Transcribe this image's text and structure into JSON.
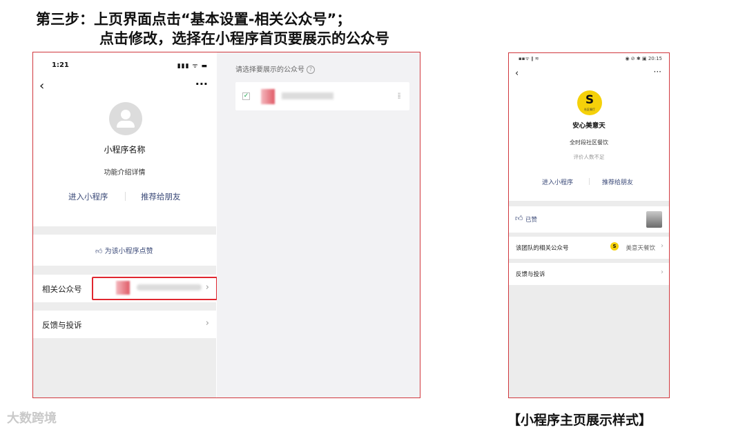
{
  "heading": {
    "line1": "第三步：上页界面点击“基本设置-相关公众号”；",
    "line2": "点击修改，选择在小程序首页要展示的公众号"
  },
  "left_phone": {
    "status_time": "1:21",
    "status_icons": "▮▮▮ ᯤ ▬",
    "back_icon": "chevron-left-icon",
    "more_icon": "more-icon",
    "app_name": "小程序名称",
    "app_desc": "功能介绍详情",
    "enter_label": "进入小程序",
    "recommend_label": "推荐给朋友",
    "like_label": "为该小程序点赞",
    "related_label": "相关公众号",
    "feedback_label": "反馈与投诉",
    "chevron": "›"
  },
  "picker_panel": {
    "prompt": "请选择要展示的公众号",
    "help": "?",
    "check": "✓",
    "grip": "⁞⁞"
  },
  "right_phone": {
    "status_left": "▪▪ᯤ ǁ ≋",
    "status_right": "◉ ⊘ ✱ ▣ 20:15",
    "back": "‹",
    "more": "···",
    "logo_letter": "S",
    "logo_text": "社区餐厅",
    "shop_name": "安心美意天",
    "shop_desc": "全时段社区餐饮",
    "rating": "评价人数不足",
    "enter_label": "进入小程序",
    "recommend_label": "推荐给朋友",
    "liked": "已赞",
    "related_label": "该团队的相关公众号",
    "related_account": "美意天餐饮",
    "feedback_label": "反馈与投诉",
    "chevron": "›"
  },
  "caption": "【小程序主页展示样式】",
  "watermark": "大数跨境",
  "colors": {
    "highlight": "#e0262f",
    "link": "#3b4a78",
    "brand_yellow": "#f5d10a"
  }
}
